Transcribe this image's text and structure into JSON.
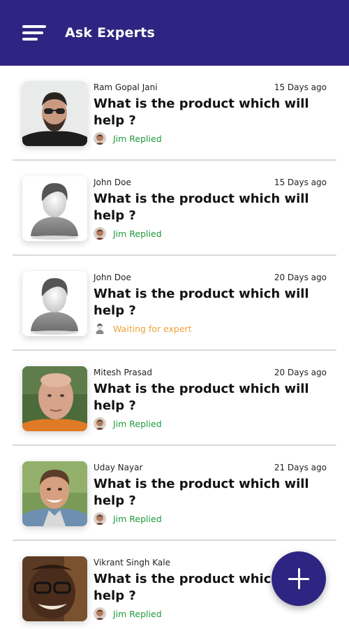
{
  "header": {
    "title": "Ask Experts"
  },
  "questions": [
    {
      "author": "Ram Gopal Jani",
      "time": "15 Days ago",
      "text": "What is the product which will help ?",
      "status": "Jim Replied",
      "status_type": "replied",
      "avatar": "photo-bearded-man"
    },
    {
      "author": "John Doe",
      "time": "15 Days ago",
      "text": "What is the product which will help ?",
      "status": "Jim Replied",
      "status_type": "replied",
      "avatar": "default-user"
    },
    {
      "author": "John Doe",
      "time": "20 Days ago",
      "text": "What is the product which will help ?",
      "status": "Waiting for expert",
      "status_type": "waiting",
      "avatar": "default-user"
    },
    {
      "author": "Mitesh Prasad",
      "time": "20 Days ago",
      "text": "What is the product which will help ?",
      "status": "Jim Replied",
      "status_type": "replied",
      "avatar": "photo-bald-man"
    },
    {
      "author": "Uday Nayar",
      "time": "21 Days ago",
      "text": "What is the product which will help ?",
      "status": "Jim Replied",
      "status_type": "replied",
      "avatar": "photo-smiling-man"
    },
    {
      "author": "Vikrant Singh Kale",
      "time": "",
      "text": "What is the product which will help ?",
      "status": "Jim Replied",
      "status_type": "replied",
      "avatar": "photo-glasses-man"
    }
  ],
  "fab": {
    "icon": "plus-icon"
  },
  "colors": {
    "primary": "#2e2481",
    "replied": "#1f9a3c",
    "waiting": "#f0a23a"
  }
}
